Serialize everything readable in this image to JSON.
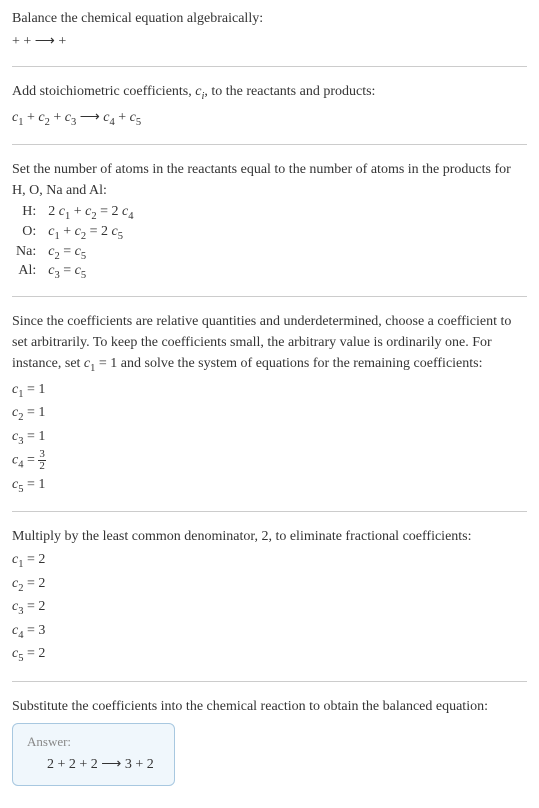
{
  "step1": {
    "title": "Balance the chemical equation algebraically:",
    "eq": " +  +  ⟶  + "
  },
  "step2": {
    "title": "Add stoichiometric coefficients, cᵢ, to the reactants and products:",
    "eq_parts": [
      "c",
      "1",
      " + c",
      "2",
      " + c",
      "3",
      "  ⟶ c",
      "4",
      " + c",
      "5"
    ]
  },
  "step3": {
    "title": "Set the number of atoms in the reactants equal to the number of atoms in the products for H, O, Na and Al:",
    "rows": [
      {
        "label": "H:",
        "eq": "2 c₁ + c₂ = 2 c₄"
      },
      {
        "label": "O:",
        "eq": "c₁ + c₂ = 2 c₅"
      },
      {
        "label": "Na:",
        "eq": "c₂ = c₅"
      },
      {
        "label": "Al:",
        "eq": "c₃ = c₅"
      }
    ]
  },
  "step4": {
    "title": "Since the coefficients are relative quantities and underdetermined, choose a coefficient to set arbitrarily. To keep the coefficients small, the arbitrary value is ordinarily one. For instance, set c₁ = 1 and solve the system of equations for the remaining coefficients:",
    "coefs": [
      "c₁ = 1",
      "c₂ = 1",
      "c₃ = 1"
    ],
    "c4_prefix": "c₄ = ",
    "c4_num": "3",
    "c4_den": "2",
    "c5": "c₅ = 1"
  },
  "step5": {
    "title": "Multiply by the least common denominator, 2, to eliminate fractional coefficients:",
    "coefs": [
      "c₁ = 2",
      "c₂ = 2",
      "c₃ = 2",
      "c₄ = 3",
      "c₅ = 2"
    ]
  },
  "step6": {
    "title": "Substitute the coefficients into the chemical reaction to obtain the balanced equation:"
  },
  "answer": {
    "label": "Answer:",
    "eq": "2  + 2  + 2  ⟶ 3  + 2 "
  }
}
